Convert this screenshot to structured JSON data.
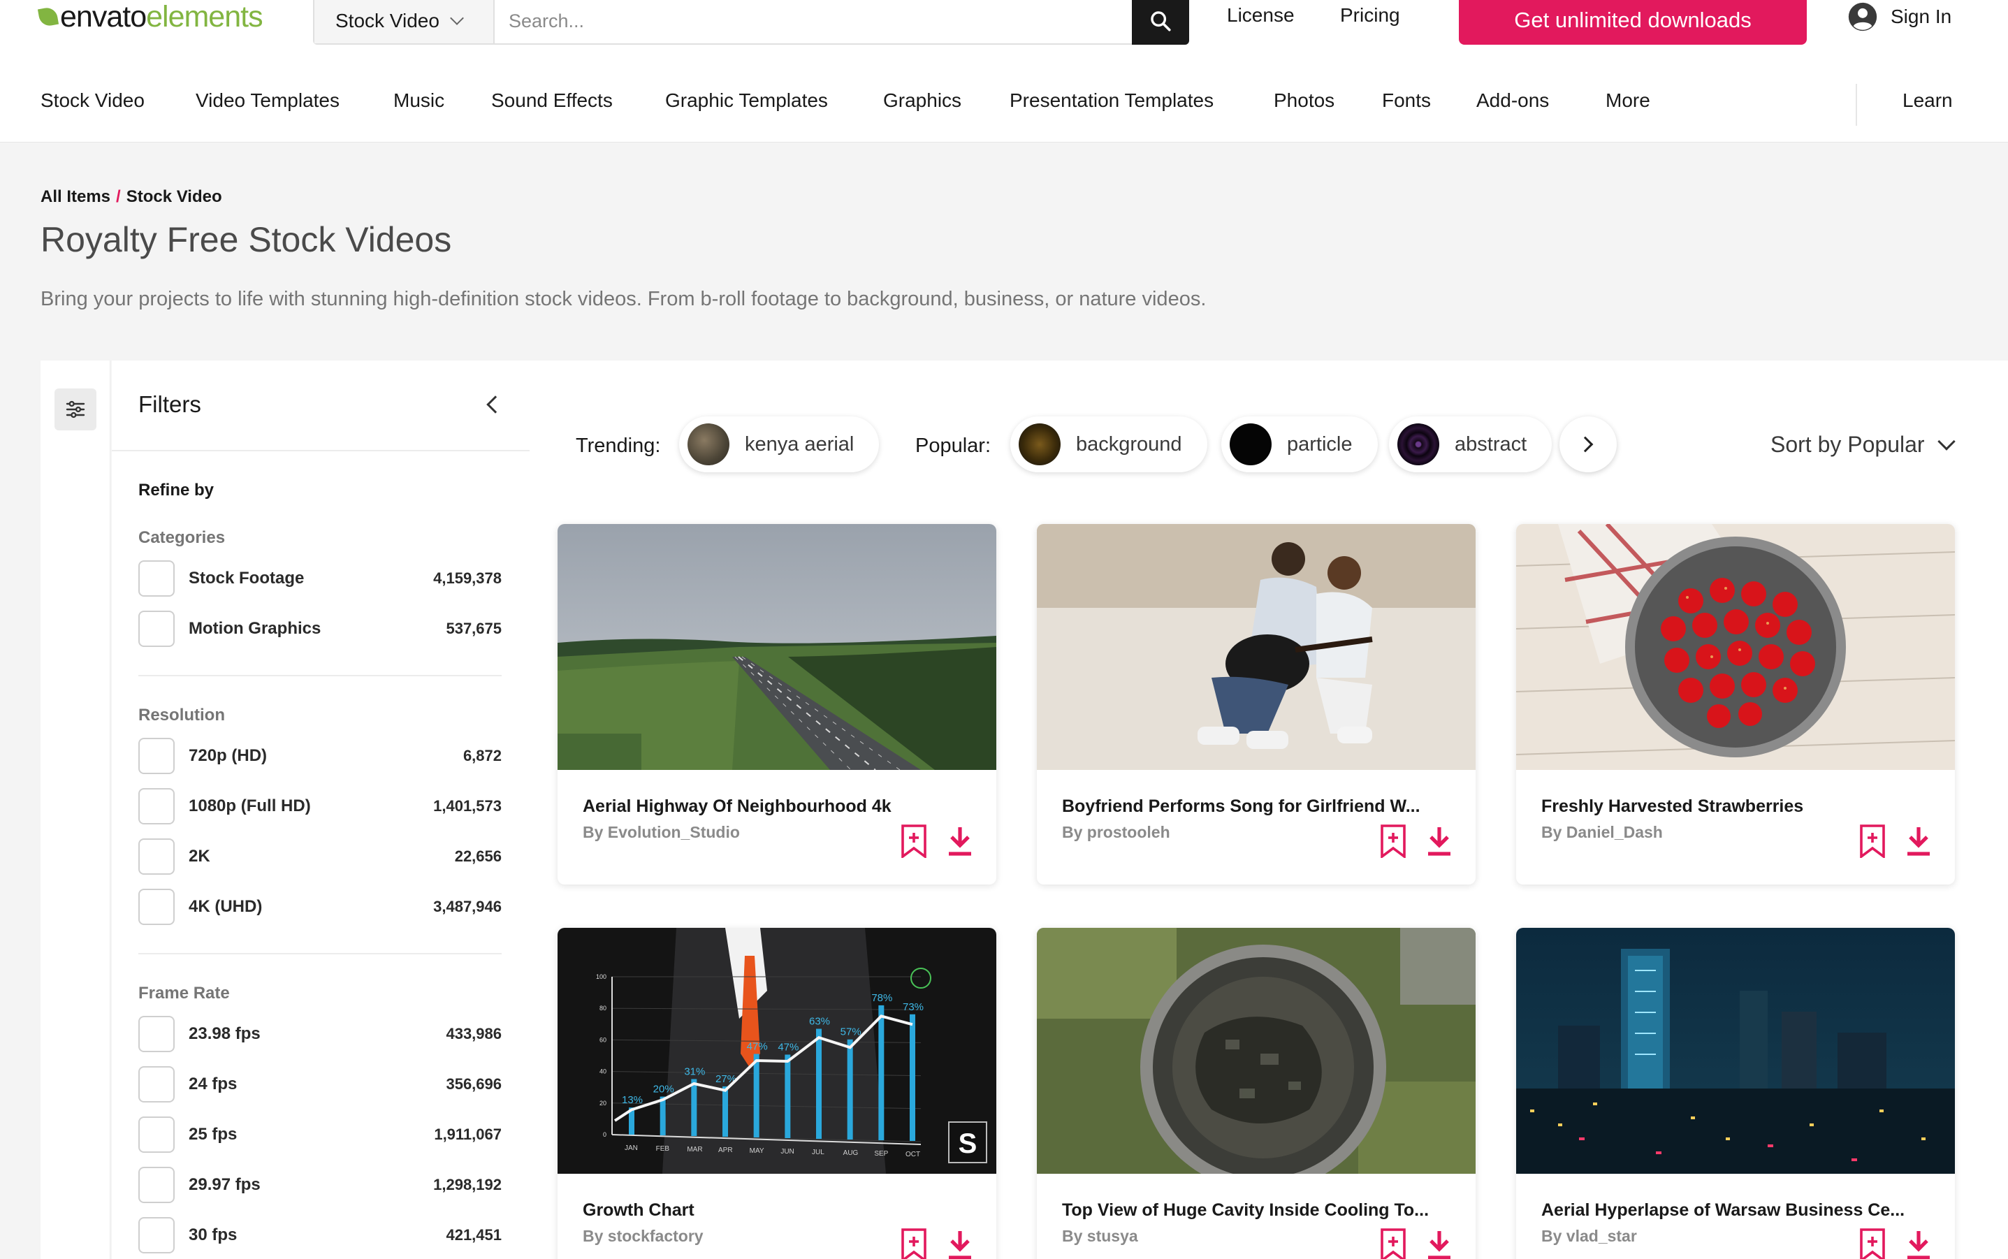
{
  "brand": {
    "word1": "envato",
    "word2": "elements",
    "accent": "#82b541"
  },
  "search": {
    "category": "Stock Video",
    "placeholder": "Search..."
  },
  "header": {
    "license": "License",
    "pricing": "Pricing",
    "cta": "Get unlimited downloads",
    "signin": "Sign In",
    "cta_color": "#e2195d"
  },
  "nav": {
    "items": [
      "Stock Video",
      "Video Templates",
      "Music",
      "Sound Effects",
      "Graphic Templates",
      "Graphics",
      "Presentation Templates",
      "Photos",
      "Fonts",
      "Add-ons",
      "More"
    ],
    "learn": "Learn"
  },
  "hero": {
    "crumb_all": "All Items",
    "crumb_sep": "/",
    "crumb_current": "Stock Video",
    "title": "Royalty Free Stock Videos",
    "description": "Bring your projects to life with stunning high-definition stock videos. From b-roll footage to background, business, or nature videos."
  },
  "filters": {
    "title": "Filters",
    "refine": "Refine by",
    "groups": [
      {
        "title": "Categories",
        "options": [
          {
            "label": "Stock Footage",
            "count": "4,159,378"
          },
          {
            "label": "Motion Graphics",
            "count": "537,675"
          }
        ]
      },
      {
        "title": "Resolution",
        "options": [
          {
            "label": "720p (HD)",
            "count": "6,872"
          },
          {
            "label": "1080p (Full HD)",
            "count": "1,401,573"
          },
          {
            "label": "2K",
            "count": "22,656"
          },
          {
            "label": "4K (UHD)",
            "count": "3,487,946"
          }
        ]
      },
      {
        "title": "Frame Rate",
        "options": [
          {
            "label": "23.98 fps",
            "count": "433,986"
          },
          {
            "label": "24 fps",
            "count": "356,696"
          },
          {
            "label": "25 fps",
            "count": "1,911,067"
          },
          {
            "label": "29.97 fps",
            "count": "1,298,192"
          },
          {
            "label": "30 fps",
            "count": "421,451"
          }
        ]
      }
    ]
  },
  "tags": {
    "trending_label": "Trending:",
    "popular_label": "Popular:",
    "trending": [
      "kenya aerial"
    ],
    "popular": [
      "background",
      "particle",
      "abstract"
    ]
  },
  "sort": {
    "label": "Sort by Popular"
  },
  "cards": [
    {
      "title": "Aerial Highway Of Neighbourhood 4k",
      "author": "By Evolution_Studio"
    },
    {
      "title": "Boyfriend Performs Song for Girlfriend W...",
      "author": "By prostooleh"
    },
    {
      "title": "Freshly Harvested Strawberries",
      "author": "By Daniel_Dash"
    },
    {
      "title": "Growth Chart",
      "author": "By stockfactory"
    },
    {
      "title": "Top View of Huge Cavity Inside Cooling To...",
      "author": "By stusya"
    },
    {
      "title": "Aerial Hyperlapse of Warsaw Business Ce...",
      "author": "By vlad_star"
    }
  ],
  "growth_chart": {
    "months": [
      "JAN",
      "FEB",
      "MAR",
      "APR",
      "MAY",
      "JUN",
      "JUL",
      "AUG",
      "SEP",
      "OCT"
    ],
    "labels": [
      "13%",
      "20%",
      "31%",
      "27%",
      "47%",
      "47%",
      "63%",
      "57%",
      "78%",
      "73%"
    ],
    "yticks": [
      "100",
      "80",
      "60",
      "40",
      "20",
      "0"
    ],
    "badge": "S"
  }
}
